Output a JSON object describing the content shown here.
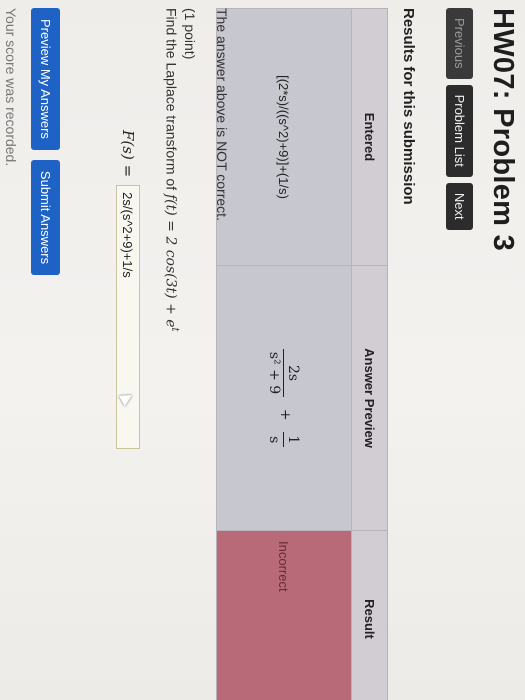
{
  "page": {
    "title": "HW07: Problem 3",
    "nav": {
      "previous": "Previous",
      "problem_list": "Problem List",
      "next": "Next"
    },
    "results_heading": "Results for this submission"
  },
  "results_table": {
    "headers": {
      "entered": "Entered",
      "answer_preview": "Answer Preview",
      "result": "Result"
    },
    "row": {
      "entered": "[(2*s)/((s^2)+9)]+(1/s)",
      "preview": {
        "frac1_num": "2s",
        "frac1_den": "s² + 9",
        "plus": "+",
        "frac2_num": "1",
        "frac2_den": "s"
      },
      "result": "Incorrect"
    }
  },
  "feedback": "The answer above is NOT correct.",
  "problem": {
    "points": "(1 point)",
    "prompt_text": "Find the Laplace transform of",
    "function_expr": "f(t) = 2 cos(3t) + e",
    "function_sup": "t",
    "answer_label": "F(s) =",
    "answer_value": "2s/(s^2+9)+1/s"
  },
  "actions": {
    "preview": "Preview My Answers",
    "submit": "Submit Answers"
  },
  "footer": {
    "recorded": "Your score was recorded."
  },
  "colors": {
    "incorrect_cell": "#b86a78",
    "primary_button": "#1e62c6",
    "nav_button": "#2c2c2c"
  }
}
